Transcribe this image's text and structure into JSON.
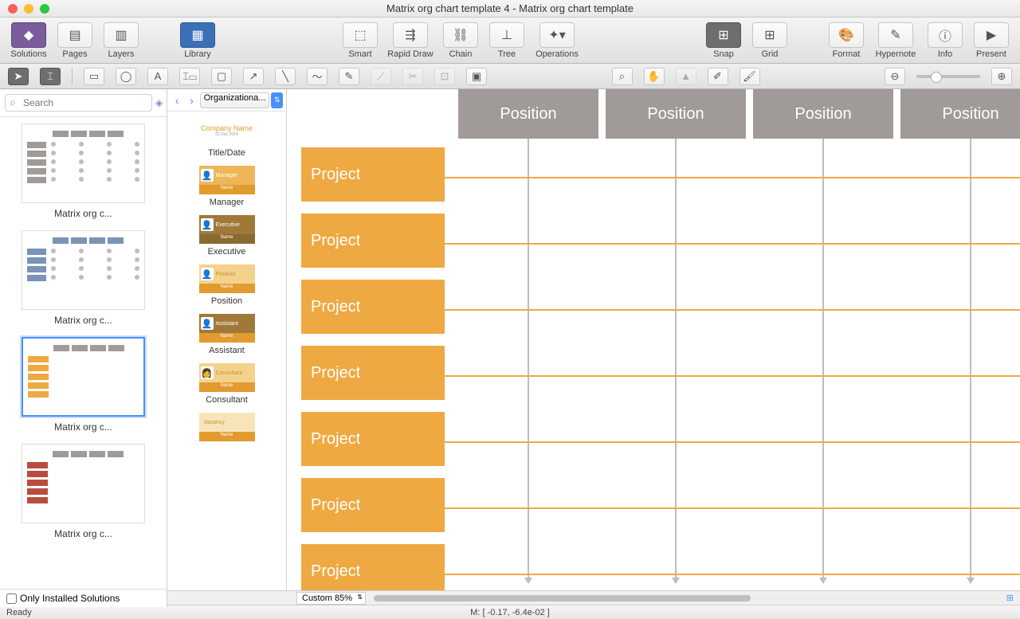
{
  "window": {
    "title": "Matrix org chart template 4 - Matrix org chart template"
  },
  "toolbar": {
    "solutions": "Solutions",
    "pages": "Pages",
    "layers": "Layers",
    "library": "Library",
    "smart": "Smart",
    "rapid_draw": "Rapid Draw",
    "chain": "Chain",
    "tree": "Tree",
    "operations": "Operations",
    "snap": "Snap",
    "grid": "Grid",
    "format": "Format",
    "hypernote": "Hypernote",
    "info": "Info",
    "present": "Present"
  },
  "search": {
    "placeholder": "Search"
  },
  "only_installed": "Only Installed Solutions",
  "templates": {
    "items": [
      {
        "label": "Matrix org c...",
        "selected": false
      },
      {
        "label": "Matrix org c...",
        "selected": false
      },
      {
        "label": "Matrix org c...",
        "selected": true
      },
      {
        "label": "Matrix org c...",
        "selected": false
      }
    ]
  },
  "library": {
    "dropdown": "Organizationa...",
    "company_name": "Company Name",
    "company_date": "02 Dec 2014",
    "name_field": "Name",
    "items": [
      {
        "label": "Title/Date",
        "role": ""
      },
      {
        "label": "Manager",
        "role": "Manager"
      },
      {
        "label": "Executive",
        "role": "Executive"
      },
      {
        "label": "Position",
        "role": "Position"
      },
      {
        "label": "Assistant",
        "role": "Assistant"
      },
      {
        "label": "Consultant",
        "role": "Consultant"
      },
      {
        "label": "",
        "role": "Vacancy"
      }
    ]
  },
  "canvas": {
    "positions": [
      "Position",
      "Position",
      "Position",
      "Position"
    ],
    "projects": [
      "Project",
      "Project",
      "Project",
      "Project",
      "Project",
      "Project",
      "Project"
    ]
  },
  "zoom": {
    "label": "Custom 85%"
  },
  "status": {
    "ready": "Ready",
    "coords": "M: [ -0.17, -6.4e-02 ]"
  }
}
